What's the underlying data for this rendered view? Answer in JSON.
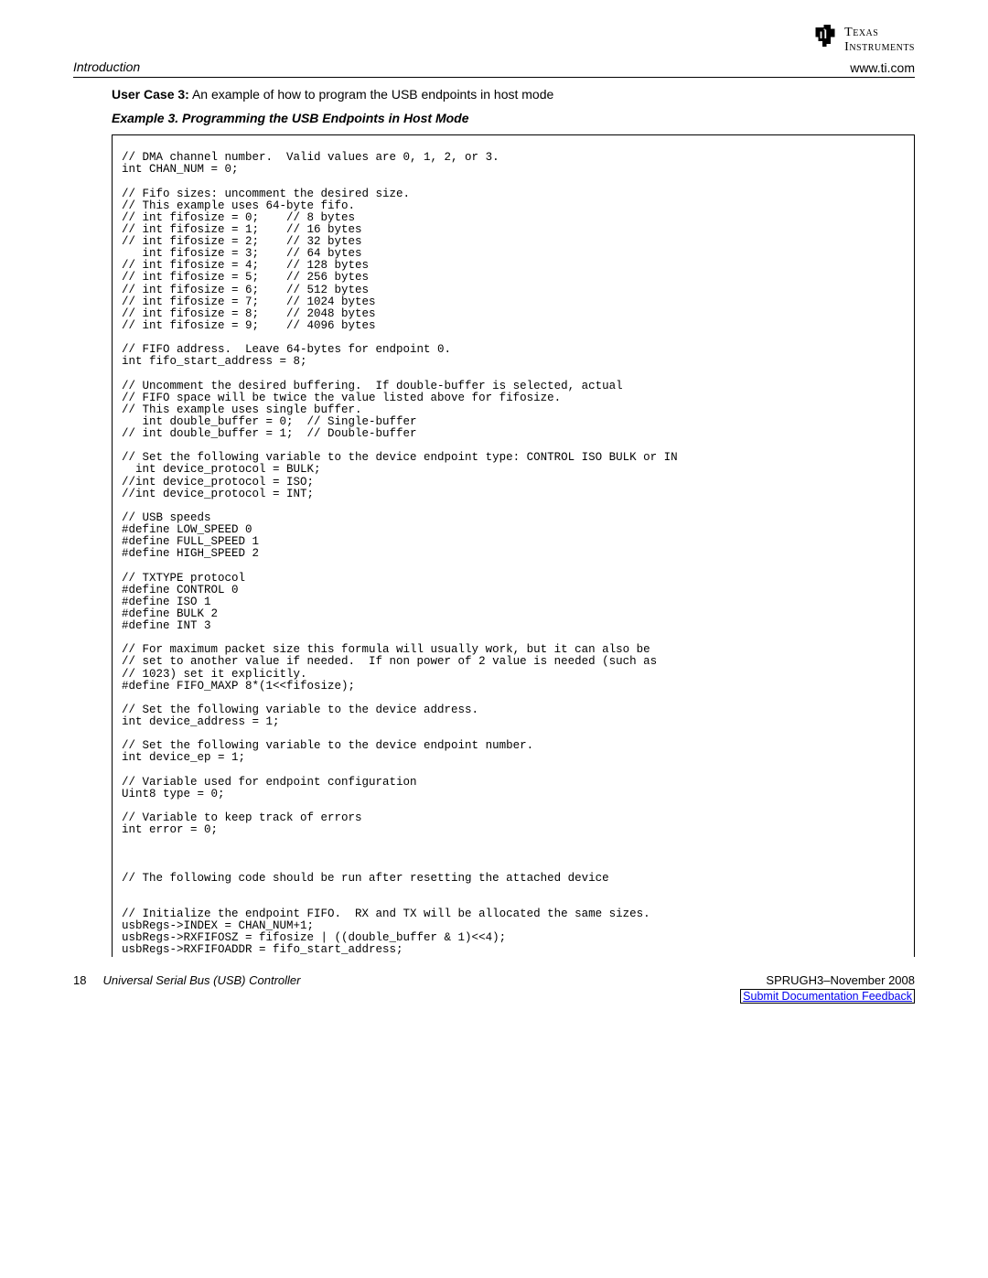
{
  "header": {
    "section": "Introduction",
    "url": "www.ti.com",
    "logo_line1": "Texas",
    "logo_line2": "Instruments"
  },
  "user_case": {
    "label": "User Case 3:",
    "text": " An example of how to program the USB endpoints in host mode"
  },
  "example_title": "Example 3. Programming the USB Endpoints in Host Mode",
  "code": "// DMA channel number.  Valid values are 0, 1, 2, or 3.\nint CHAN_NUM = 0;\n\n// Fifo sizes: uncomment the desired size.\n// This example uses 64-byte fifo.\n// int fifosize = 0;    // 8 bytes\n// int fifosize = 1;    // 16 bytes\n// int fifosize = 2;    // 32 bytes\n   int fifosize = 3;    // 64 bytes\n// int fifosize = 4;    // 128 bytes\n// int fifosize = 5;    // 256 bytes\n// int fifosize = 6;    // 512 bytes\n// int fifosize = 7;    // 1024 bytes\n// int fifosize = 8;    // 2048 bytes\n// int fifosize = 9;    // 4096 bytes\n\n// FIFO address.  Leave 64-bytes for endpoint 0.\nint fifo_start_address = 8;\n\n// Uncomment the desired buffering.  If double-buffer is selected, actual\n// FIFO space will be twice the value listed above for fifosize.\n// This example uses single buffer.\n   int double_buffer = 0;  // Single-buffer\n// int double_buffer = 1;  // Double-buffer\n\n// Set the following variable to the device endpoint type: CONTROL ISO BULK or IN\n  int device_protocol = BULK;\n//int device_protocol = ISO;\n//int device_protocol = INT;\n\n// USB speeds\n#define LOW_SPEED 0\n#define FULL_SPEED 1\n#define HIGH_SPEED 2\n\n// TXTYPE protocol\n#define CONTROL 0\n#define ISO 1\n#define BULK 2\n#define INT 3\n\n// For maximum packet size this formula will usually work, but it can also be\n// set to another value if needed.  If non power of 2 value is needed (such as\n// 1023) set it explicitly.\n#define FIFO_MAXP 8*(1<<fifosize);\n\n// Set the following variable to the device address.\nint device_address = 1;\n\n// Set the following variable to the device endpoint number.\nint device_ep = 1;\n\n// Variable used for endpoint configuration\nUint8 type = 0;\n\n// Variable to keep track of errors\nint error = 0;\n\n\n\n// The following code should be run after resetting the attached device\n\n\n// Initialize the endpoint FIFO.  RX and TX will be allocated the same sizes.\nusbRegs->INDEX = CHAN_NUM+1;\nusbRegs->RXFIFOSZ = fifosize | ((double_buffer & 1)<<4);\nusbRegs->RXFIFOADDR = fifo_start_address;",
  "footer": {
    "page_number": "18",
    "doc_title": "Universal Serial Bus (USB) Controller",
    "doc_id_date": "SPRUGH3–November 2008",
    "feedback_link": "Submit Documentation Feedback"
  }
}
